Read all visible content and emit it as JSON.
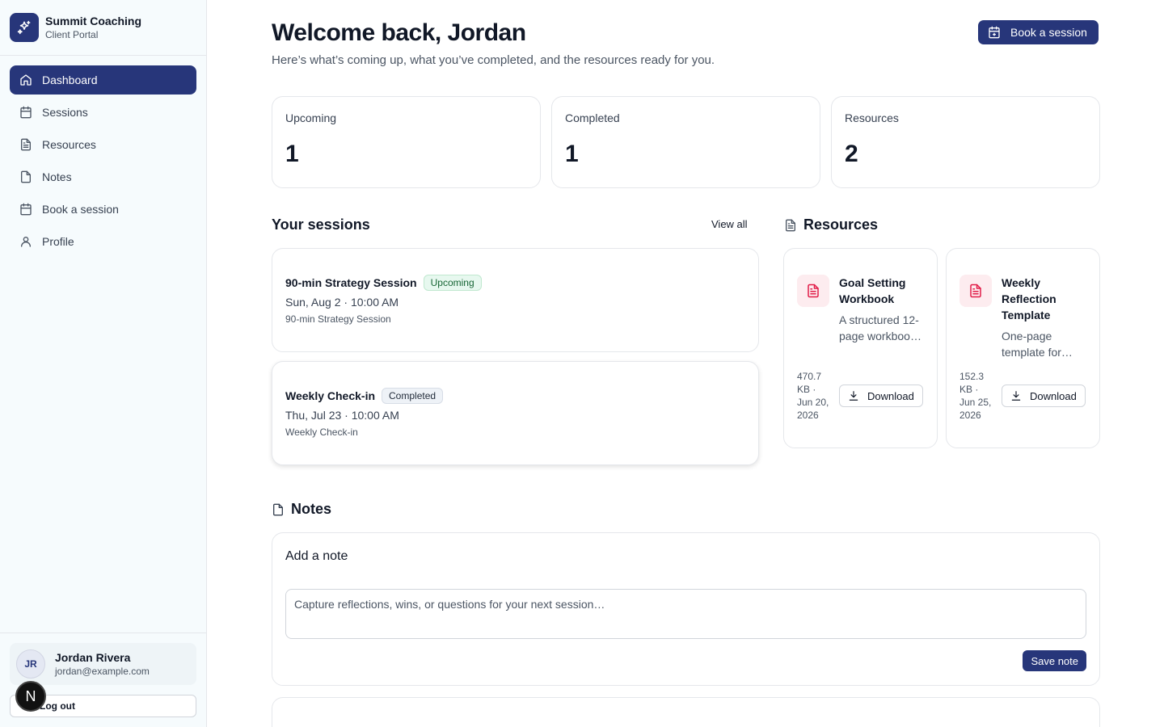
{
  "brand": {
    "name": "Summit Coaching",
    "subtitle": "Client Portal"
  },
  "nav": [
    {
      "label": "Dashboard",
      "icon": "home-icon",
      "active": true
    },
    {
      "label": "Sessions",
      "icon": "calendar-icon"
    },
    {
      "label": "Resources",
      "icon": "file-text-icon"
    },
    {
      "label": "Notes",
      "icon": "note-icon"
    },
    {
      "label": "Book a session",
      "icon": "calendar-icon"
    },
    {
      "label": "Profile",
      "icon": "user-icon"
    }
  ],
  "user": {
    "initials": "JR",
    "name": "Jordan Rivera",
    "email": "jordan@example.com",
    "logout_label": "Log out"
  },
  "dev_badge": "N",
  "header": {
    "title": "Welcome back, Jordan",
    "subtitle": "Here’s what’s coming up, what you’ve completed, and the resources ready for you.",
    "book_label": "Book a session"
  },
  "stats": [
    {
      "label": "Upcoming",
      "value": "1"
    },
    {
      "label": "Completed",
      "value": "1"
    },
    {
      "label": "Resources",
      "value": "2"
    }
  ],
  "sessions": {
    "title": "Your sessions",
    "view_all": "View all",
    "items": [
      {
        "title": "90-min Strategy Session",
        "status": "Upcoming",
        "when": "Sun, Aug 2 · 10:00 AM",
        "type": "90-min Strategy Session"
      },
      {
        "title": "Weekly Check-in",
        "status": "Completed",
        "when": "Thu, Jul 23 · 10:00 AM",
        "type": "Weekly Check-in"
      }
    ]
  },
  "resources": {
    "title": "Resources",
    "items": [
      {
        "title_lines": [
          "Goal Setting",
          "Workbook"
        ],
        "desc_lines": [
          "A structured 12-",
          "page workboo…"
        ],
        "meta_lines": [
          "470.7",
          "KB ·",
          "Jun 20,",
          "2026"
        ],
        "download_label": "Download"
      },
      {
        "title_lines": [
          "Weekly",
          "Reflection",
          "Template"
        ],
        "desc_lines": [
          "One-page",
          "template for…"
        ],
        "meta_lines": [
          "152.3",
          "KB ·",
          "Jun 25,",
          "2026"
        ],
        "download_label": "Download"
      }
    ]
  },
  "notes": {
    "title": "Notes",
    "card_title": "Add a note",
    "placeholder": "Capture reflections, wins, or questions for your next session…",
    "save_label": "Save note"
  },
  "colors": {
    "brand": "#27367a",
    "upcoming_badge": "#e7f8ef",
    "resource_icon": "#e11d48"
  }
}
